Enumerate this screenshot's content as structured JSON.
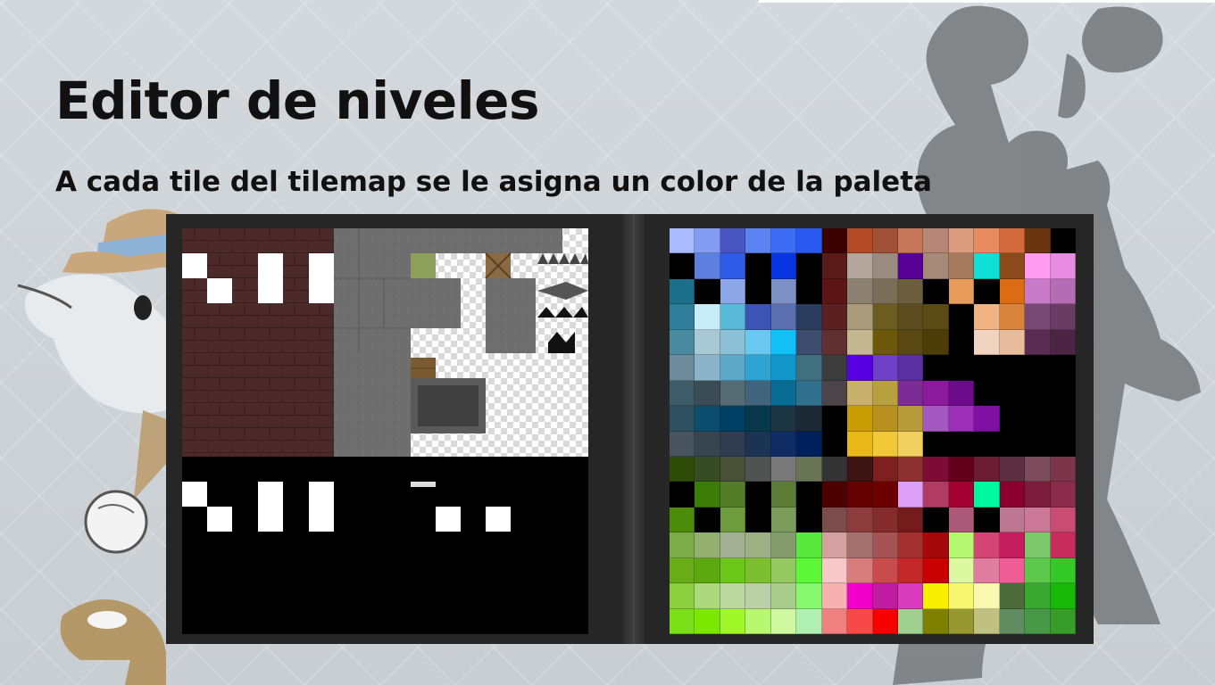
{
  "slide": {
    "title": "Editor de niveles",
    "subtitle": "A cada tile del tilemap se le asigna un color de la paleta"
  },
  "palette_colors": [
    [
      "#a9baff",
      "#839cf2",
      "#4a56c1",
      "#5b83f2",
      "#3d6cf5",
      "#2a5af2",
      "#3b0000",
      "#b24a25",
      "#a15137",
      "#c8765a",
      "#b48673",
      "#dc9c7f",
      "#e88a5d",
      "#d26a3c",
      "#6a3510",
      "#000000"
    ],
    [
      "#000000",
      "#5c7fe0",
      "#2e5be7",
      "#000000",
      "#0634e0",
      "#000000",
      "#5a1a1a",
      "#b4a69a",
      "#9a8c80",
      "#560096",
      "#a58a78",
      "#a37a5c",
      "#0ee0d6",
      "#8a4a1a",
      "#ff9cf0",
      "#e78ae2"
    ],
    [
      "#1c6f8a",
      "#000000",
      "#8ca6e8",
      "#000000",
      "#7c90c4",
      "#000000",
      "#5c1414",
      "#8c8070",
      "#7a6e58",
      "#6a5e3c",
      "#000000",
      "#e89c5c",
      "#000000",
      "#dc6c14",
      "#c87ac8",
      "#b46cb4"
    ],
    [
      "#2f7f9a",
      "#c8ecf8",
      "#58b8d8",
      "#3c54b4",
      "#5c70b0",
      "#2a3c5c",
      "#5c2020",
      "#a89c7c",
      "#6c5c20",
      "#5c4c20",
      "#5a4a14",
      "#000000",
      "#f0b484",
      "#d8843c",
      "#7a4874",
      "#6a3c64"
    ],
    [
      "#4a8aa0",
      "#a8c8d4",
      "#8cc0d4",
      "#68c8f0",
      "#12c0f8",
      "#3c4c6c",
      "#603030",
      "#c4b890",
      "#6c5808",
      "#5a4814",
      "#4c3c08",
      "#000000",
      "#f0d4c0",
      "#e8bc9c",
      "#5a2c54",
      "#4c2444"
    ],
    [
      "#6c8c9c",
      "#8cb4c8",
      "#5ca8c8",
      "#30a4d0",
      "#1096c8",
      "#407080",
      "#3c3c3c",
      "#5800e0",
      "#7040c8",
      "#5a30a0",
      "#000000",
      "#000000",
      "#000000",
      "#000000",
      "#000000",
      "#000000"
    ],
    [
      "#3c5c68",
      "#3c4c54",
      "#566c74",
      "#40647c",
      "#086c94",
      "#30708c",
      "#4c4448",
      "#c8b06c",
      "#b8a040",
      "#7c2c94",
      "#8c1a9c",
      "#6c0c8c",
      "#000000",
      "#000000",
      "#000000",
      "#000000"
    ],
    [
      "#2c5060",
      "#0c4c6c",
      "#004064",
      "#08384c",
      "#1c3444",
      "#1c2834",
      "#000000",
      "#ca9c04",
      "#b89020",
      "#b89c3c",
      "#a458c0",
      "#9c30b8",
      "#8010a4",
      "#000000",
      "#000000",
      "#000000"
    ],
    [
      "#485460",
      "#384450",
      "#303c50",
      "#1c3454",
      "#102c64",
      "#00205c",
      "#000000",
      "#e8b818",
      "#f0c838",
      "#f0d060",
      "#000000",
      "#000000",
      "#000000",
      "#000000",
      "#000000",
      "#000000"
    ],
    [
      "#2c4c08",
      "#384c24",
      "#485038",
      "#505450",
      "#787878",
      "#687454",
      "#343434",
      "#3c1414",
      "#7c2020",
      "#8c3030",
      "#7c0c34",
      "#64001c",
      "#6c1c34",
      "#5c3040",
      "#7c4c5c",
      "#7c3448"
    ],
    [
      "#000000",
      "#3c7c08",
      "#547c28",
      "#000000",
      "#5c7c38",
      "#000000",
      "#4c0000",
      "#640000",
      "#6c0000",
      "#dca0f8",
      "#b03c64",
      "#a40034",
      "#00f8a0",
      "#8c0030",
      "#7c1c3c",
      "#8c2c4c"
    ],
    [
      "#4c8c08",
      "#000000",
      "#6c9c3c",
      "#000000",
      "#7c9c5c",
      "#000000",
      "#7c4c4c",
      "#8c3c3c",
      "#842c2c",
      "#741c1c",
      "#000000",
      "#ac5878",
      "#000000",
      "#bc7890",
      "#cc7898",
      "#c84c74"
    ],
    [
      "#7cac48",
      "#94b070",
      "#a4b094",
      "#9cb084",
      "#849c6c",
      "#58e83c",
      "#d4a0a0",
      "#a47070",
      "#a45454",
      "#a43030",
      "#a40808",
      "#b4f870",
      "#d44474",
      "#c41c5c",
      "#7cc86c",
      "#c82c5c"
    ],
    [
      "#68ac18",
      "#5ca810",
      "#6cc818",
      "#7cc030",
      "#94c860",
      "#5cf838",
      "#f8c8c8",
      "#d87c7c",
      "#c84c4c",
      "#c42828",
      "#c80000",
      "#dcf8a0",
      "#e07ca0",
      "#f05c94",
      "#5cc84c",
      "#34c828"
    ],
    [
      "#8cd040",
      "#acd87c",
      "#bcd8a0",
      "#bcd0a8",
      "#a8cc8c",
      "#88f870",
      "#f8b0b0",
      "#f000c8",
      "#c01ca0",
      "#d83cbc",
      "#f8f000",
      "#f8f870",
      "#f8f8b0",
      "#4c6c3c",
      "#38a830",
      "#18b808"
    ],
    [
      "#7ce018",
      "#7ce800",
      "#a0f828",
      "#b8f870",
      "#d0f8a0",
      "#b0f0b0",
      "#f08080",
      "#f84848",
      "#f80000",
      "#a0d090",
      "#808000",
      "#989830",
      "#c0c080",
      "#608c60",
      "#489848",
      "#389c28"
    ]
  ]
}
